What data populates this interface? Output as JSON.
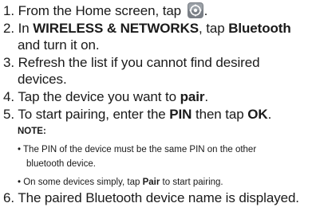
{
  "steps": {
    "s1": {
      "num": "1.",
      "pre": "From the Home screen, tap",
      "icon": "settings-icon",
      "post": "."
    },
    "s2": {
      "num": "2.",
      "pre": "In",
      "bold1": "WIRELESS & NETWORKS",
      "mid": ", tap",
      "bold2": "Bluetooth",
      "cont": "and turn it on."
    },
    "s3": {
      "num": "3.",
      "line1": "Refresh the list if you cannot find desired",
      "cont": "devices."
    },
    "s4": {
      "num": "4.",
      "pre": "Tap the device you want to",
      "bold": "pair",
      "post": "."
    },
    "s5": {
      "num": "5.",
      "pre": "To start pairing, enter the",
      "bold1": "PIN",
      "mid": "then tap",
      "bold2": "OK",
      "post": "."
    },
    "s6": {
      "num": "6.",
      "text": "The paired Bluetooth device name is displayed."
    }
  },
  "note": {
    "title": "NOTE:",
    "b1": {
      "bullet": "•",
      "text": "The PIN of the device must be the same PIN on the other",
      "cont": "bluetooth device."
    },
    "b2": {
      "bullet": "•",
      "pre": "On some devices simply, tap",
      "bold": "Pair",
      "post": "to start pairing."
    }
  },
  "colors": {
    "text": "#1a1a1a",
    "icon_bg": "#7a7f86"
  }
}
